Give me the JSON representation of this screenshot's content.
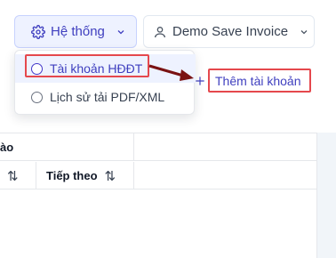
{
  "toolbar": {
    "system_label": "Hệ thống",
    "system_icon": "gear-icon",
    "system_chevron": "chevron-down-icon",
    "user_label": "Demo Save Invoice",
    "user_icon": "user-icon",
    "user_chevron": "chevron-down-icon"
  },
  "dropdown": {
    "items": [
      {
        "label": "Tài khoản HĐĐT",
        "active": true
      },
      {
        "label": "Lịch sử tải PDF/XML",
        "active": false
      }
    ]
  },
  "actions": {
    "add_account_label": "Thêm tài khoản",
    "add_icon": "plus-icon"
  },
  "table": {
    "headers": [
      {
        "label": "ào",
        "sortable": false
      },
      {
        "label": "",
        "sortable": true
      },
      {
        "label": "Tiếp theo",
        "sortable": true
      }
    ],
    "sort_glyph": "⇅"
  },
  "colors": {
    "accent": "#3f3fbf",
    "highlight": "#e5484d",
    "arrow": "#7a1212"
  }
}
